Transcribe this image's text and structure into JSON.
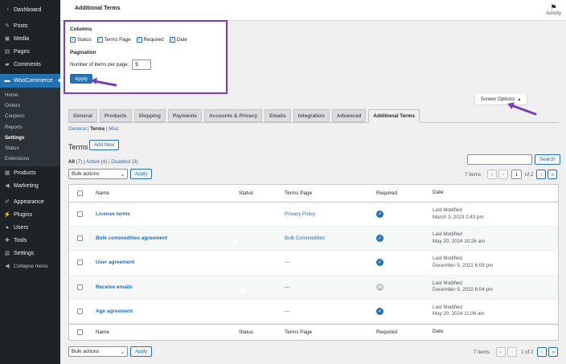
{
  "sidebar": {
    "items": [
      {
        "icon": "dashboard-icon",
        "label": "Dashboard"
      },
      {
        "icon": "pin-icon",
        "label": "Posts"
      },
      {
        "icon": "media-icon",
        "label": "Media"
      },
      {
        "icon": "pages-icon",
        "label": "Pages"
      },
      {
        "icon": "comments-icon",
        "label": "Comments"
      }
    ],
    "active": {
      "icon": "woocommerce-icon",
      "label": "WooCommerce"
    },
    "submenu": [
      "Home",
      "Orders",
      "Coupons",
      "Reports",
      "Settings",
      "Status",
      "Extensions"
    ],
    "submenu_current": "Settings",
    "items_after": [
      {
        "icon": "products-icon",
        "label": "Products"
      },
      {
        "icon": "marketing-icon",
        "label": "Marketing"
      }
    ],
    "items_bottom": [
      {
        "icon": "appearance-icon",
        "label": "Appearance"
      },
      {
        "icon": "plugins-icon",
        "label": "Plugins"
      },
      {
        "icon": "users-icon",
        "label": "Users"
      },
      {
        "icon": "tools-icon",
        "label": "Tools"
      },
      {
        "icon": "settings-icon",
        "label": "Settings"
      },
      {
        "icon": "collapse-icon",
        "label": "Collapse menu"
      }
    ]
  },
  "header": {
    "title": "Additional Terms",
    "activity_label": "Activity"
  },
  "screen_options": {
    "columns_heading": "Columns",
    "columns": [
      "Status",
      "Terms Page",
      "Required",
      "Date"
    ],
    "pagination_heading": "Pagination",
    "per_page_label": "Number of items per page:",
    "per_page_value": "5",
    "apply_label": "Apply",
    "tab_label": "Screen Options"
  },
  "tabs": [
    "General",
    "Products",
    "Shipping",
    "Payments",
    "Accounts & Privacy",
    "Emails",
    "Integration",
    "Advanced",
    "Additional Terms"
  ],
  "active_tab": "Additional Terms",
  "subsubsub": {
    "general": "General",
    "terms": "Terms",
    "misc": "Misc",
    "sep": "|"
  },
  "page": {
    "heading": "Terms",
    "add_new": "Add New"
  },
  "views": {
    "all": "All",
    "all_count": "(7)",
    "active": "Active",
    "active_count": "(4)",
    "disabled": "Disabled",
    "disabled_count": "(3)",
    "sep": "|"
  },
  "search_button": "Search",
  "bulk_actions": "Bulk actions",
  "apply": "Apply",
  "pagination_top": {
    "items": "7 items",
    "current": "1",
    "of": "of 2"
  },
  "pagination_bottom": {
    "items": "7 items",
    "text": "1 of 2"
  },
  "table": {
    "headers": {
      "name": "Name",
      "status": "Status",
      "page": "Terms Page",
      "required": "Required",
      "date": "Date"
    },
    "rows": [
      {
        "name": "License terms",
        "status": "on",
        "page": "Privacy Policy",
        "required": true,
        "date_label": "Last Modified",
        "date": "March 3, 2023 2:43 pm"
      },
      {
        "name": "Bulk commodities agreement",
        "status": "on",
        "page": "Bulk Commodities",
        "required": true,
        "date_label": "Last Modified",
        "date": "May 20, 2024 10:26 am"
      },
      {
        "name": "User agreement",
        "status": "off",
        "page": "—",
        "required": true,
        "date_label": "Last Modified",
        "date": "December 9, 2022 6:09 pm"
      },
      {
        "name": "Receive emails",
        "status": "off",
        "page": "—",
        "required": false,
        "date_label": "Last Modified",
        "date": "December 9, 2022 6:04 pm"
      },
      {
        "name": "Age agreement",
        "status": "on",
        "page": "—",
        "required": true,
        "date_label": "Last Modified",
        "date": "May 20, 2024 11:06 am"
      }
    ]
  },
  "colors": {
    "accent": "#2271b1",
    "highlight": "#7b3fb3",
    "sidebar": "#1d2327"
  }
}
